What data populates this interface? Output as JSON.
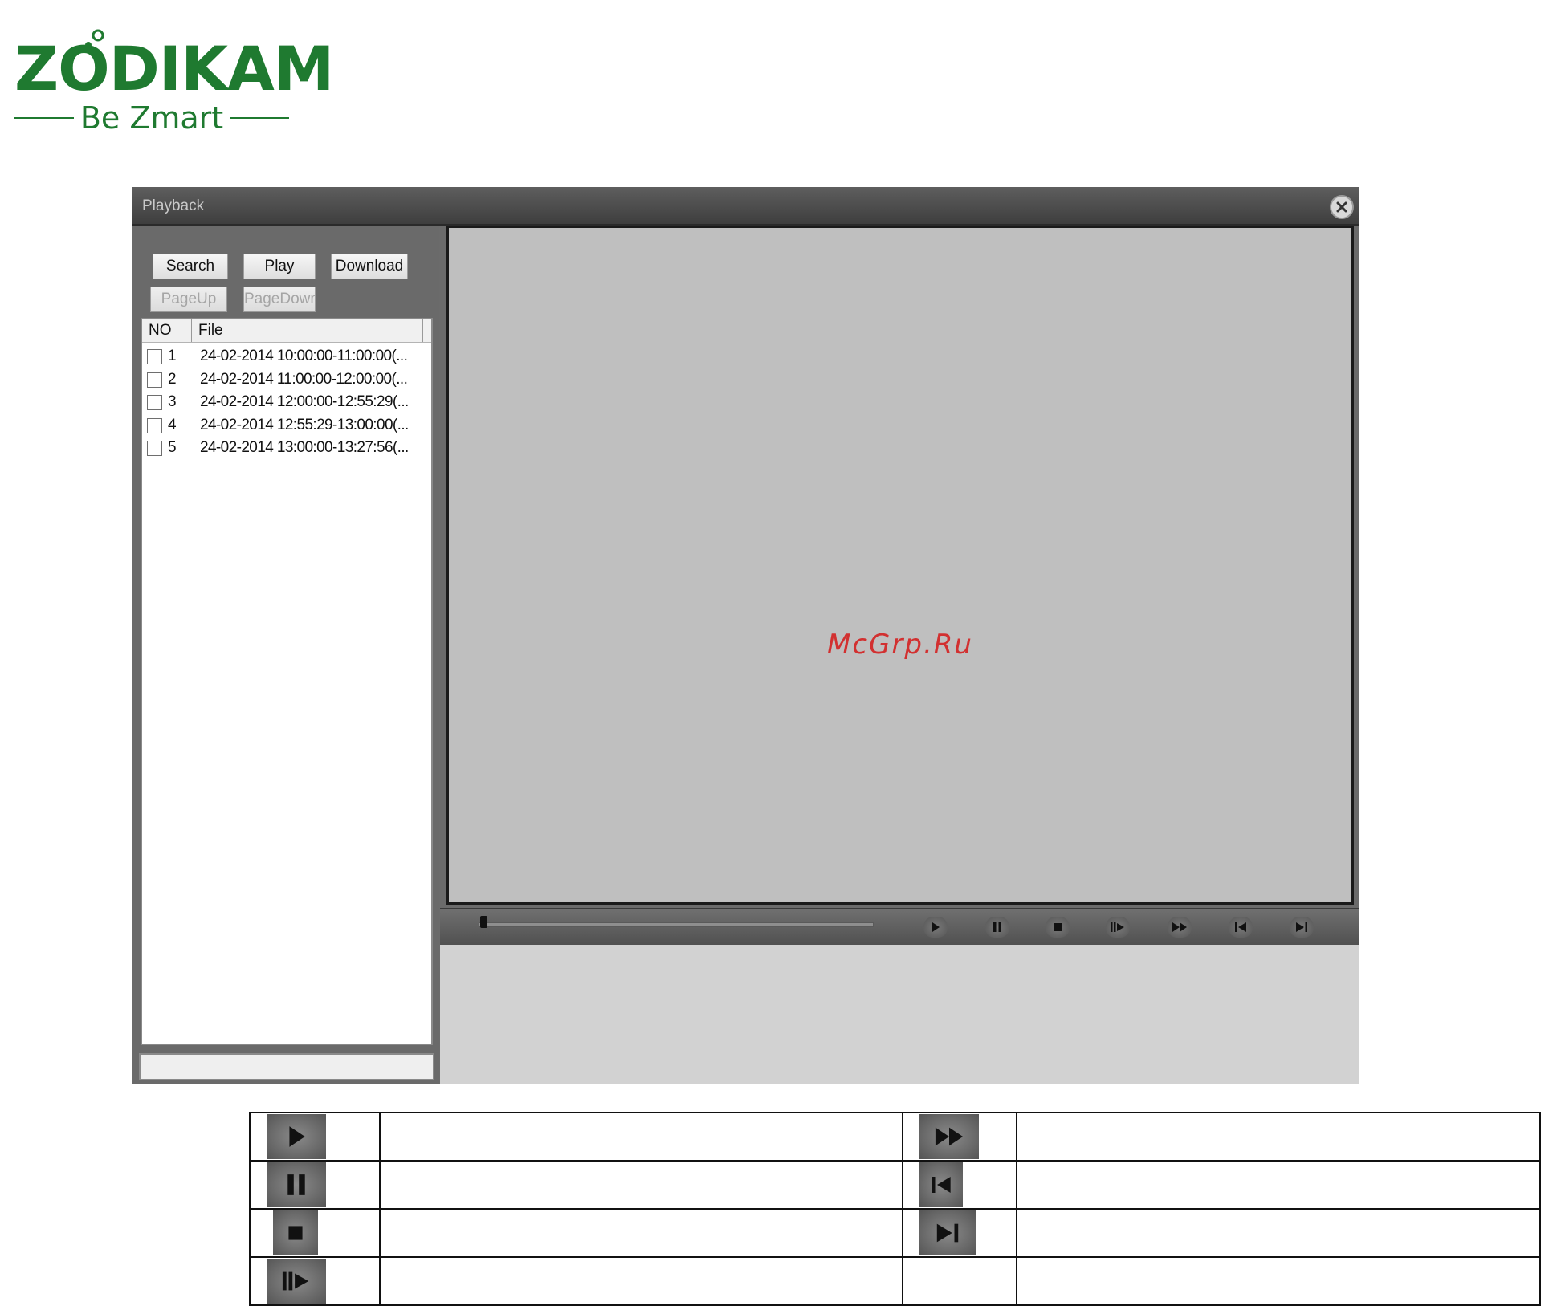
{
  "logo": {
    "brand": "ZODIKAM",
    "tagline": "Be Zmart"
  },
  "window": {
    "title": "Playback",
    "close_icon": "close-icon"
  },
  "toolbar": {
    "search_label": "Search",
    "play_label": "Play",
    "download_label": "Download",
    "pageup_label": "PageUp",
    "pagedown_label": "PageDown"
  },
  "file_list": {
    "columns": {
      "no": "NO",
      "file": "File"
    },
    "rows": [
      {
        "no": "1",
        "file": "24-02-2014 10:00:00-11:00:00(..."
      },
      {
        "no": "2",
        "file": "24-02-2014 11:00:00-12:00:00(..."
      },
      {
        "no": "3",
        "file": "24-02-2014 12:00:00-12:55:29(..."
      },
      {
        "no": "4",
        "file": "24-02-2014 12:55:29-13:00:00(..."
      },
      {
        "no": "5",
        "file": "24-02-2014 13:00:00-13:27:56(..."
      }
    ]
  },
  "video": {
    "watermark": "McGrp.Ru"
  },
  "controls": {
    "progress": 0.0,
    "buttons": [
      "play-icon",
      "pause-icon",
      "stop-icon",
      "slow-forward-icon",
      "fast-forward-icon",
      "previous-frame-icon",
      "next-frame-icon"
    ]
  },
  "legend": {
    "icons": [
      "play-icon",
      "pause-icon",
      "stop-icon",
      "slow-forward-icon",
      "fast-forward-icon",
      "previous-frame-icon",
      "next-frame-icon"
    ]
  },
  "colors": {
    "brand_green": "#1f7a30",
    "watermark_red": "#d23030",
    "video_bg": "#bfbfbf"
  }
}
